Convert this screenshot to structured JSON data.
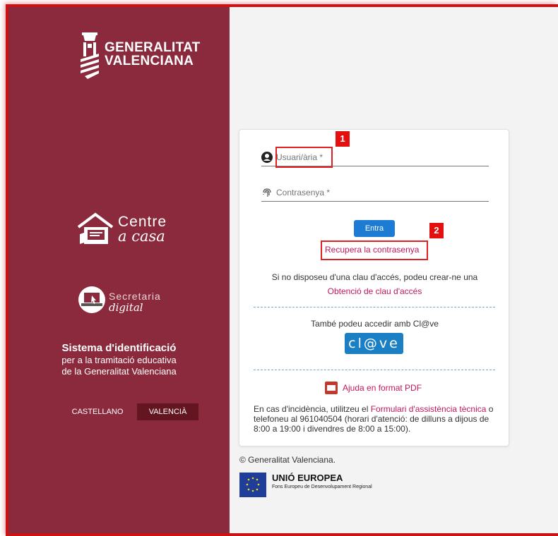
{
  "sidebar": {
    "logo_line1": "GENERALITAT",
    "logo_line2": "VALENCIANA",
    "centre_line1": "Centre",
    "centre_line2": "a casa",
    "secretaria_line1": "Secretaria",
    "secretaria_line2": "digital",
    "system_title": "Sistema d'identificació",
    "system_sub1": "per a la tramitació educativa",
    "system_sub2": "de la Generalitat Valenciana",
    "lang_es": "CASTELLANO",
    "lang_va": "VALENCIÀ"
  },
  "login": {
    "user_placeholder": "Usuari/ària *",
    "password_placeholder": "Contrasenya *",
    "submit": "Entra",
    "recover": "Recupera la contrasenya",
    "no_key_text": "Si no disposeu d'una clau d'accés, podeu crear-ne una",
    "get_key": "Obtenció de clau d'accés",
    "clave_text": "També podeu accedir amb Cl@ve",
    "clave_button": "cl@ve",
    "pdf_help": "Ajuda en format PDF",
    "incident_prefix": "En cas d'incidència, utilitzeu el ",
    "incident_link": "Formulari d'assistència tècnica",
    "incident_suffix": " o telefoneu al 961040504 (horari d'atenció: de dilluns a dijous de 8:00 a 19:00 i divendres de 8:00 a 15:00)."
  },
  "annotations": {
    "badge1": "1",
    "badge2": "2"
  },
  "footer": {
    "copyright": "© Generalitat Valenciana.",
    "eu_title": "UNIÓ EUROPEA",
    "eu_sub": "Fons Europeu de Desenvolupament Regional"
  },
  "colors": {
    "sidebar": "#8b2a3c",
    "accent_link": "#c2185b",
    "button_blue": "#1c7bd3",
    "highlight_red": "#e02020"
  }
}
